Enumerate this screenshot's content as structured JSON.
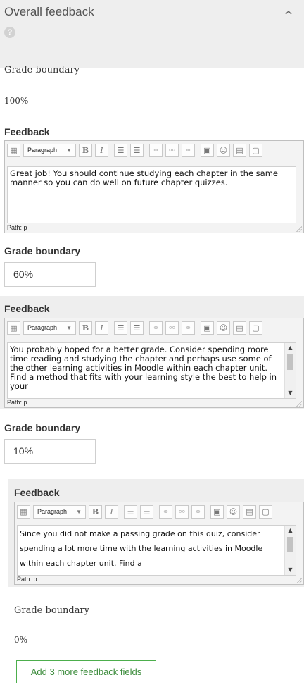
{
  "header": {
    "title": "Overall feedback",
    "help": "?",
    "collapse_icon": "chevron-up-icon"
  },
  "labels": {
    "grade_boundary": "Grade boundary",
    "feedback": "Feedback",
    "path": "Path: p"
  },
  "toolbar": {
    "format_select": "Paragraph",
    "buttons": [
      "toggle-toolbar-icon",
      "bold-icon",
      "italic-icon",
      "bulleted-list-icon",
      "numbered-list-icon",
      "link-icon",
      "unlink-icon",
      "anchor-icon",
      "image-icon",
      "emoticon-icon",
      "media-icon",
      "paste-text-icon"
    ],
    "bold_glyph": "B",
    "italic_glyph": "I"
  },
  "entries": [
    {
      "grade_boundary": "100%",
      "feedback": "Great job! You should continue studying each chapter in the same manner so you can do well on future chapter quizzes."
    },
    {
      "grade_boundary": "60%",
      "feedback": "You probably hoped for a better grade. Consider spending more time reading and studying the chapter and perhaps use some of the other learning activities in Moodle within each chapter unit. Find a method that fits with your learning style the best to help in your"
    },
    {
      "grade_boundary": "10%",
      "feedback": "Since you did not make a passing grade on this quiz, consider spending a lot more time with the learning activities in Moodle within each chapter unit. Find a"
    },
    {
      "grade_boundary": "0%"
    }
  ],
  "add_button": "Add 3 more feedback fields"
}
